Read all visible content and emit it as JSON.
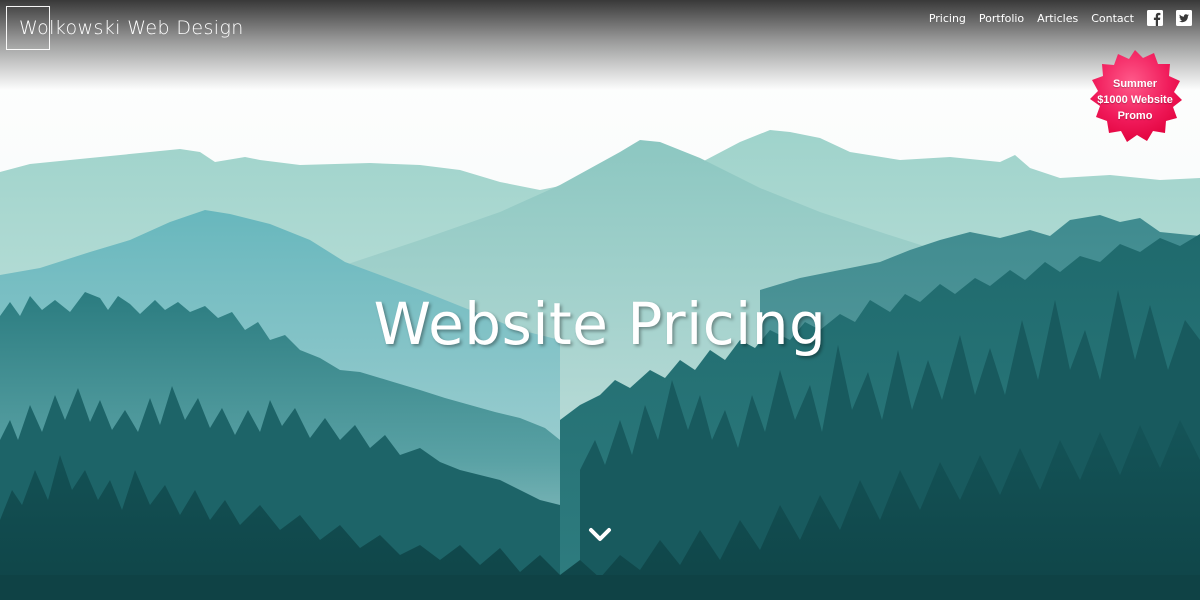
{
  "header": {
    "logo_text": "Wolkowski Web Design",
    "nav": [
      {
        "label": "Pricing"
      },
      {
        "label": "Portfolio"
      },
      {
        "label": "Articles"
      },
      {
        "label": "Contact"
      }
    ],
    "social_icons": [
      "facebook-icon",
      "twitter-icon"
    ]
  },
  "promo": {
    "line1": "Summer",
    "line2": "$1000 Website",
    "line3": "Promo",
    "color": "#f0165a"
  },
  "hero": {
    "title": "Website Pricing",
    "scroll_icon": "chevron-down-icon"
  }
}
